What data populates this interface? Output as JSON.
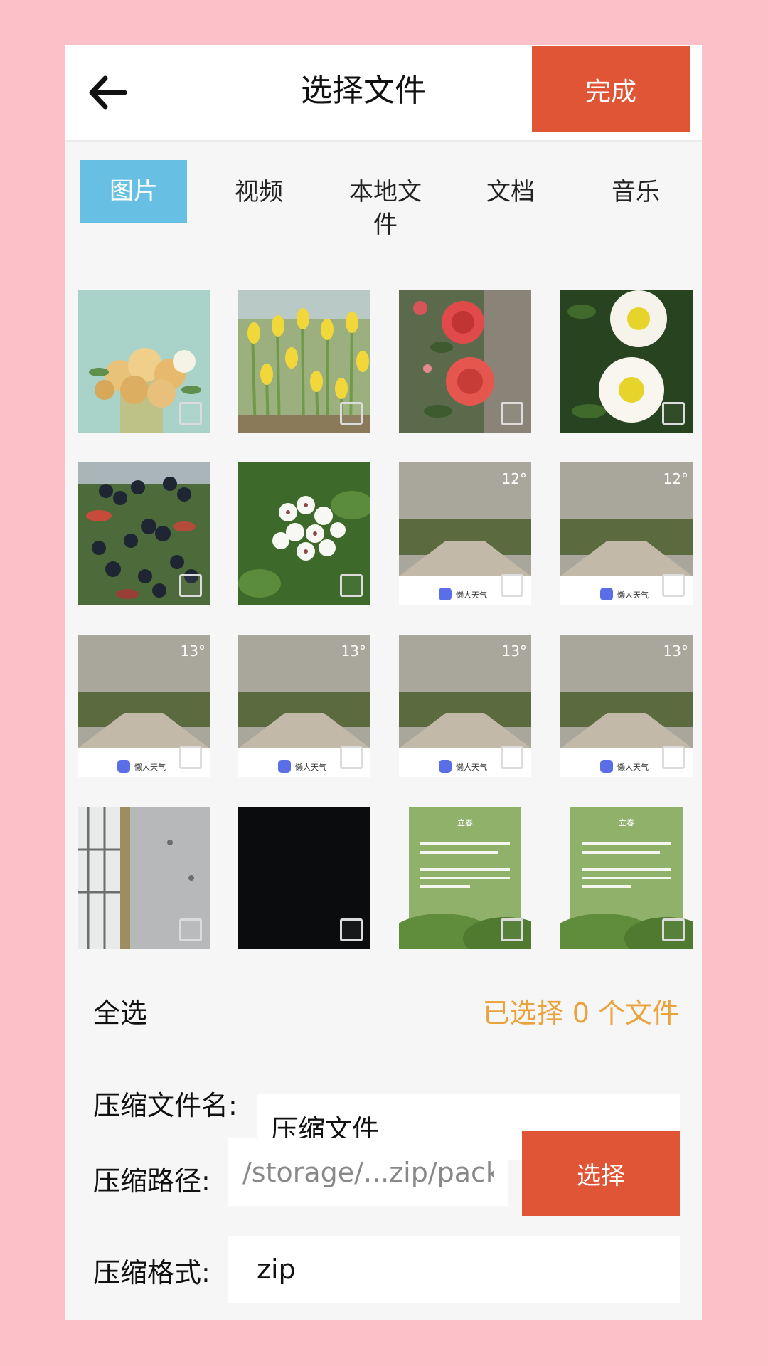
{
  "header": {
    "back_icon": "arrow-left-icon",
    "title": "选择文件",
    "done_label": "完成"
  },
  "tabs": [
    {
      "label": "图片",
      "active": true
    },
    {
      "label": "视频",
      "active": false
    },
    {
      "label": "本地文件",
      "active": false
    },
    {
      "label": "文档",
      "active": false
    },
    {
      "label": "音乐",
      "active": false
    }
  ],
  "grid": {
    "items": [
      {
        "kind": "photo-yellow-roses"
      },
      {
        "kind": "photo-yellow-tulips"
      },
      {
        "kind": "photo-red-roses"
      },
      {
        "kind": "photo-white-flowers"
      },
      {
        "kind": "photo-dark-berries"
      },
      {
        "kind": "photo-white-blossom"
      },
      {
        "kind": "weather-card",
        "temp": "12°",
        "app": "懒人天气"
      },
      {
        "kind": "weather-card",
        "temp": "12°",
        "app": "懒人天气"
      },
      {
        "kind": "weather-card",
        "temp": "13°",
        "app": "懒人天气"
      },
      {
        "kind": "weather-card",
        "temp": "13°",
        "app": "懒人天气"
      },
      {
        "kind": "weather-card",
        "temp": "13°",
        "app": "懒人天气"
      },
      {
        "kind": "weather-card",
        "temp": "13°",
        "app": "懒人天气"
      },
      {
        "kind": "photo-window"
      },
      {
        "kind": "photo-black"
      },
      {
        "kind": "poster-spring",
        "title": "立春"
      },
      {
        "kind": "poster-spring",
        "title": "立春"
      }
    ]
  },
  "bottom": {
    "select_all": "全选",
    "selected_count": "已选择 0 个文件",
    "name_label": "压缩文件名:",
    "name_value": "压缩文件",
    "path_label": "压缩路径:",
    "path_value": "/storage/...zip/pack",
    "choose_label": "选择",
    "format_label": "压缩格式:",
    "format_value": "zip"
  },
  "colors": {
    "accent": "#e05535",
    "tab_active": "#67c0e3",
    "selected_text": "#eaa23c",
    "background": "#fbc0c8"
  }
}
